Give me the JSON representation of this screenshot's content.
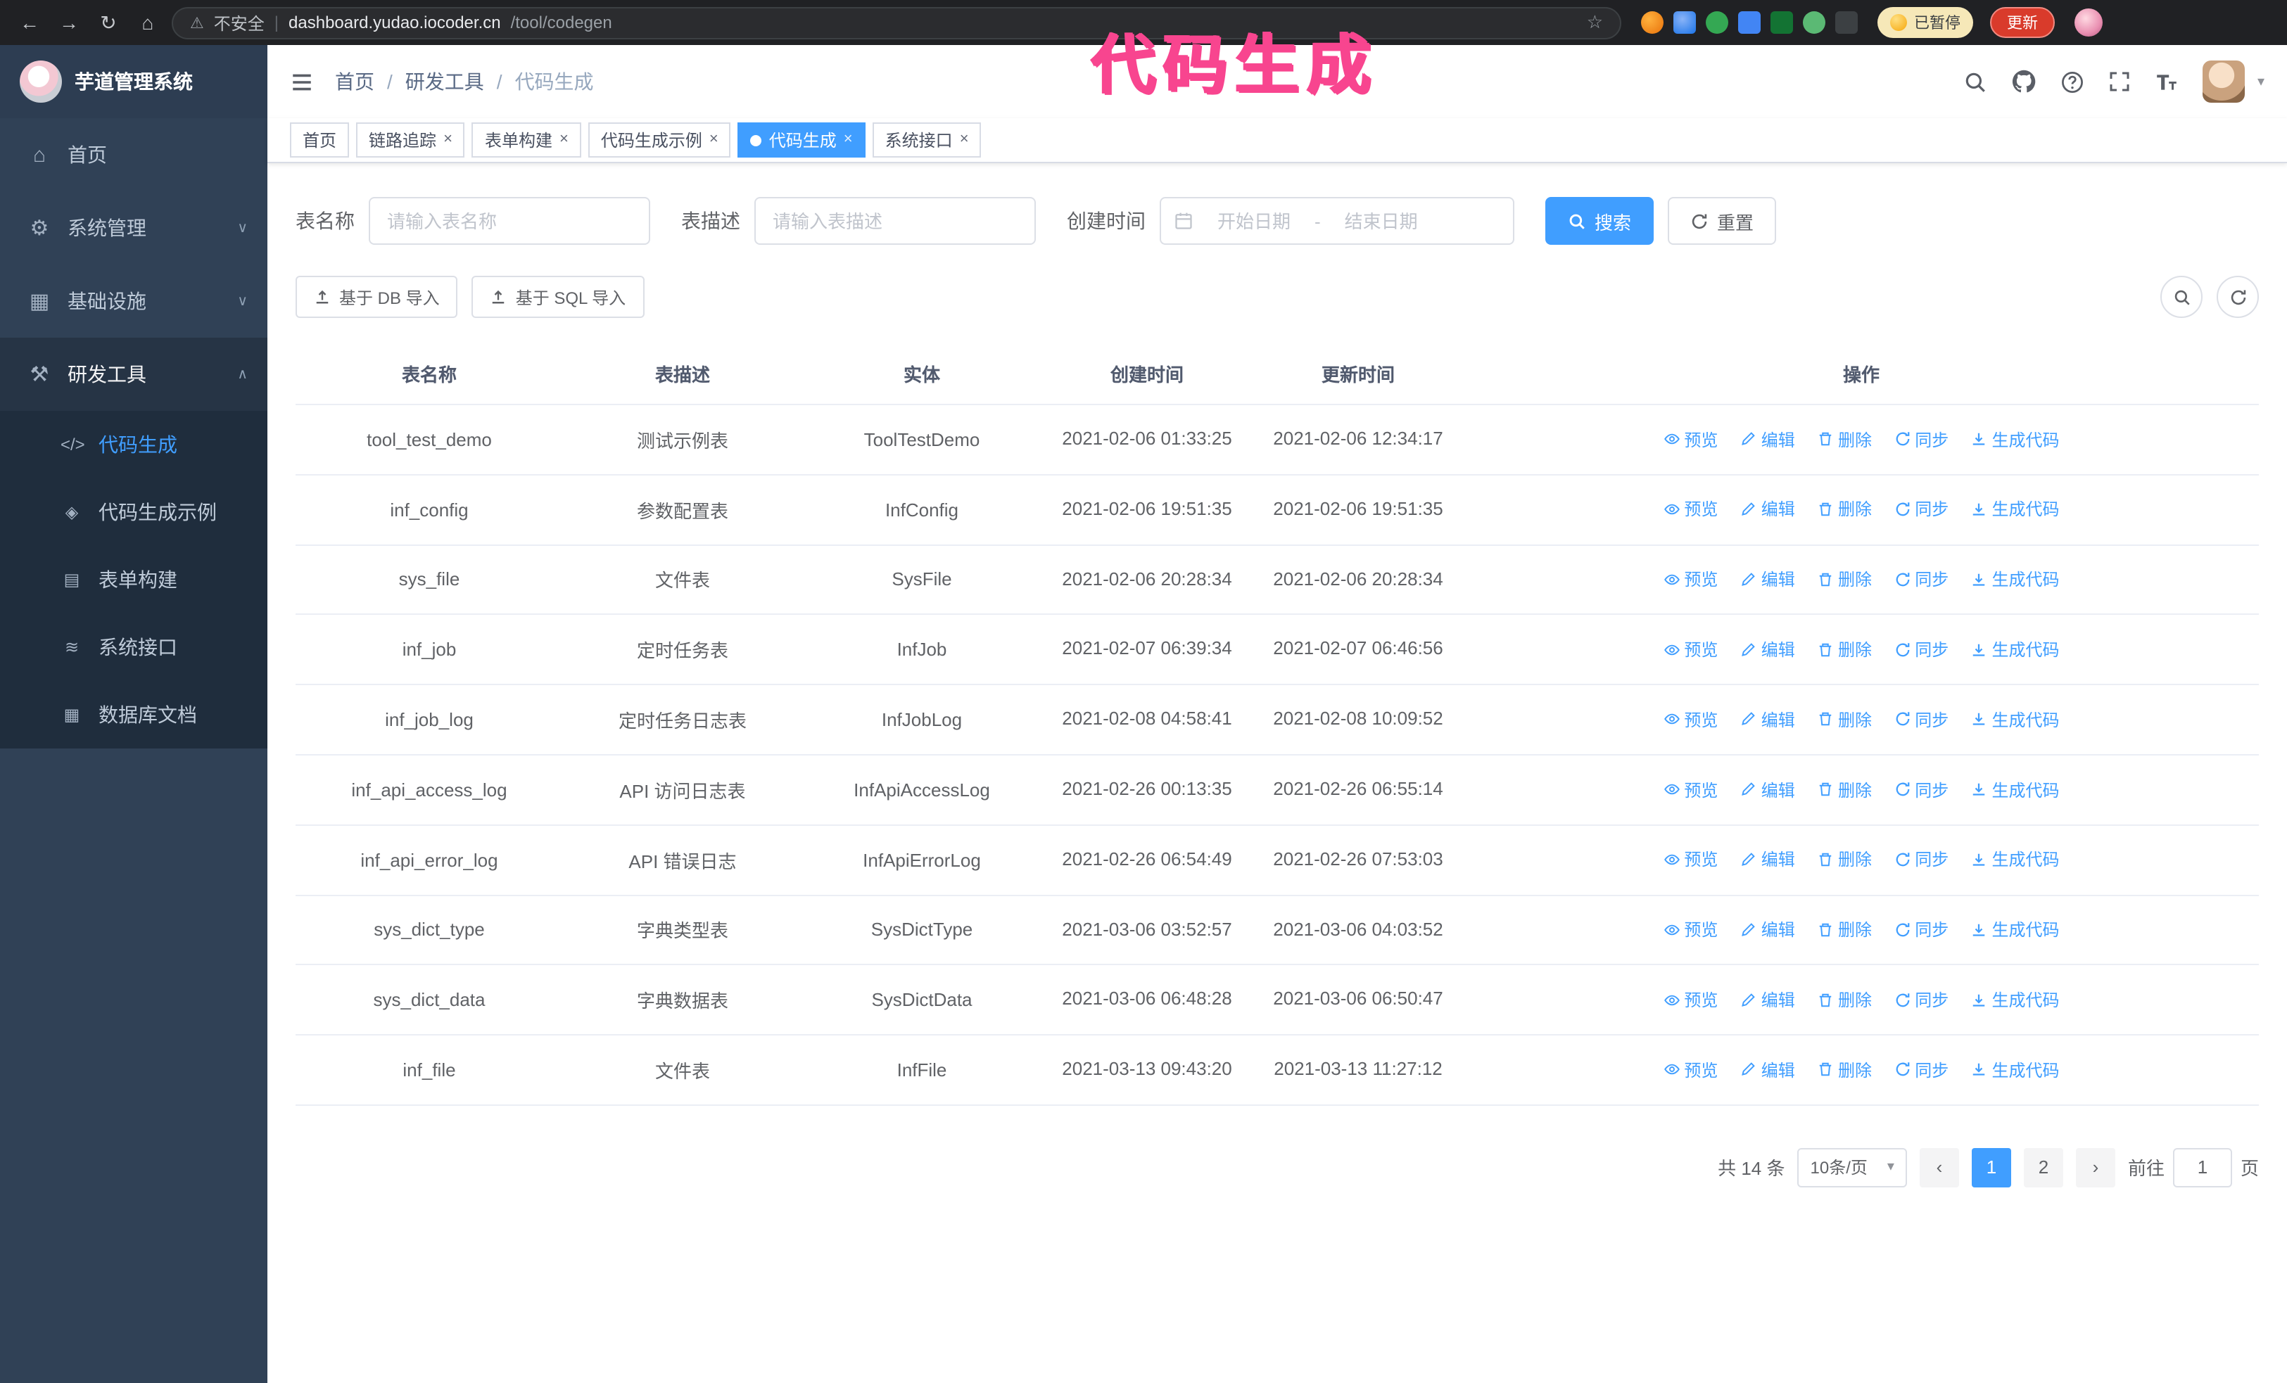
{
  "browser": {
    "security_label": "不安全",
    "url_host": "dashboard.yudao.iocoder.cn",
    "url_path": "/tool/codegen",
    "paused_badge": "已暂停",
    "update_button": "更新"
  },
  "overlay": {
    "annotation": "代码生成"
  },
  "icons": {
    "back": "←",
    "forward": "→",
    "reload": "↻",
    "home": "⌂",
    "warning": "⚠",
    "divider": "|",
    "star": "☆",
    "caret_down": "▾",
    "chevron_down": "∨",
    "chevron_up": "∧",
    "close": "×",
    "prev": "‹",
    "next": "›",
    "date_sep": "-",
    "menu_home": "⌂",
    "menu_system": "⚙",
    "menu_infra": "▦",
    "menu_tools": "⚒",
    "sub_codegen": "</>",
    "sub_example": "◈",
    "sub_form": "▤",
    "sub_api": "≋",
    "sub_db": "▦"
  },
  "sidebar": {
    "logo_title": "芋道管理系统",
    "items": [
      {
        "label": "首页"
      },
      {
        "label": "系统管理"
      },
      {
        "label": "基础设施"
      },
      {
        "label": "研发工具"
      }
    ],
    "subitems": [
      {
        "label": "代码生成"
      },
      {
        "label": "代码生成示例"
      },
      {
        "label": "表单构建"
      },
      {
        "label": "系统接口"
      },
      {
        "label": "数据库文档"
      }
    ]
  },
  "header": {
    "breadcrumb": [
      "首页",
      "研发工具",
      "代码生成"
    ]
  },
  "tabs": [
    {
      "label": "首页"
    },
    {
      "label": "链路追踪"
    },
    {
      "label": "表单构建"
    },
    {
      "label": "代码生成示例"
    },
    {
      "label": "代码生成"
    },
    {
      "label": "系统接口"
    }
  ],
  "filters": {
    "table_name_label": "表名称",
    "table_name_placeholder": "请输入表名称",
    "table_desc_label": "表描述",
    "table_desc_placeholder": "请输入表描述",
    "create_time_label": "创建时间",
    "date_start_placeholder": "开始日期",
    "date_end_placeholder": "结束日期",
    "search_button": "搜索",
    "reset_button": "重置"
  },
  "toolbar": {
    "import_db": "基于 DB 导入",
    "import_sql": "基于 SQL 导入"
  },
  "table": {
    "columns": [
      "表名称",
      "表描述",
      "实体",
      "创建时间",
      "更新时间",
      "操作"
    ],
    "actions": [
      "预览",
      "编辑",
      "删除",
      "同步",
      "生成代码"
    ],
    "rows": [
      {
        "name": "tool_test_demo",
        "desc": "测试示例表",
        "entity": "ToolTestDemo",
        "created": "2021-02-06 01:33:25",
        "updated": "2021-02-06 12:34:17"
      },
      {
        "name": "inf_config",
        "desc": "参数配置表",
        "entity": "InfConfig",
        "created": "2021-02-06 19:51:35",
        "updated": "2021-02-06 19:51:35"
      },
      {
        "name": "sys_file",
        "desc": "文件表",
        "entity": "SysFile",
        "created": "2021-02-06 20:28:34",
        "updated": "2021-02-06 20:28:34"
      },
      {
        "name": "inf_job",
        "desc": "定时任务表",
        "entity": "InfJob",
        "created": "2021-02-07 06:39:34",
        "updated": "2021-02-07 06:46:56"
      },
      {
        "name": "inf_job_log",
        "desc": "定时任务日志表",
        "entity": "InfJobLog",
        "created": "2021-02-08 04:58:41",
        "updated": "2021-02-08 10:09:52"
      },
      {
        "name": "inf_api_access_log",
        "desc": "API 访问日志表",
        "entity": "InfApiAccessLog",
        "created": "2021-02-26 00:13:35",
        "updated": "2021-02-26 06:55:14"
      },
      {
        "name": "inf_api_error_log",
        "desc": "API 错误日志",
        "entity": "InfApiErrorLog",
        "created": "2021-02-26 06:54:49",
        "updated": "2021-02-26 07:53:03"
      },
      {
        "name": "sys_dict_type",
        "desc": "字典类型表",
        "entity": "SysDictType",
        "created": "2021-03-06 03:52:57",
        "updated": "2021-03-06 04:03:52"
      },
      {
        "name": "sys_dict_data",
        "desc": "字典数据表",
        "entity": "SysDictData",
        "created": "2021-03-06 06:48:28",
        "updated": "2021-03-06 06:50:47"
      },
      {
        "name": "inf_file",
        "desc": "文件表",
        "entity": "InfFile",
        "created": "2021-03-13 09:43:20",
        "updated": "2021-03-13 11:27:12"
      }
    ]
  },
  "pagination": {
    "total": "共 14 条",
    "page_size": "10条/页",
    "pages": [
      "1",
      "2"
    ],
    "goto_label": "前往",
    "goto_value": "1",
    "page_label": "页"
  },
  "colors": {
    "accent": "#409eff",
    "sidebar_bg": "#304156",
    "submenu_bg": "#1f2d3d",
    "annotation": "#f8458f",
    "active_tab_bg": "#409eff"
  }
}
